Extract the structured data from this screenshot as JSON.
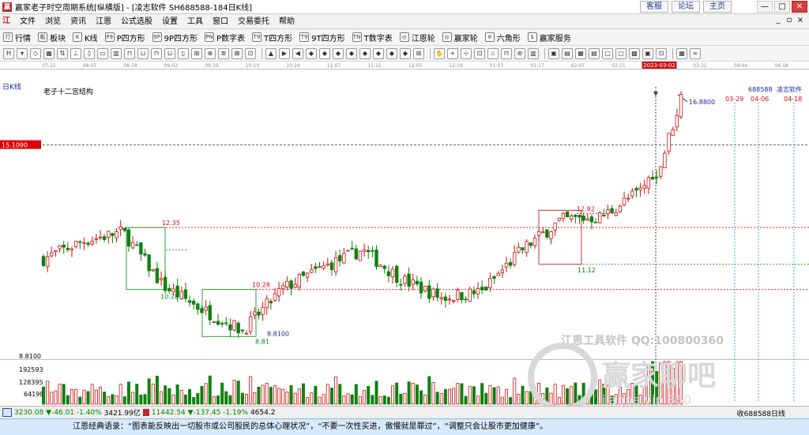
{
  "window": {
    "title": "赢家老子时空周期系统[纵横版] - [凌志软件  SH688588-184日K线]",
    "links": [
      "客服",
      "论坛",
      "主页"
    ],
    "buttons": [
      "—",
      "□",
      "✕"
    ]
  },
  "menu": {
    "items": [
      "文件",
      "浏览",
      "资讯",
      "江恩",
      "公式选股",
      "设置",
      "工具",
      "窗口",
      "交易委托",
      "帮助"
    ]
  },
  "toolbar1": {
    "items": [
      {
        "icon": "行",
        "label": "行情"
      },
      {
        "icon": "板",
        "label": "板块"
      },
      {
        "icon": "K",
        "label": "K线"
      },
      {
        "icon": "P9",
        "label": "P四方形"
      },
      {
        "icon": "9P",
        "label": "9P四方形"
      },
      {
        "icon": "PN",
        "label": "P数字表"
      },
      {
        "icon": "T9",
        "label": "T四方形"
      },
      {
        "icon": "T9",
        "label": "9T四方形"
      },
      {
        "icon": "TN",
        "label": "T数字表"
      },
      {
        "icon": "◎",
        "label": "江恩轮"
      },
      {
        "icon": "◎",
        "label": "赢家轮"
      },
      {
        "icon": "✡",
        "label": "六角形"
      },
      {
        "icon": "$",
        "label": "赢家服务"
      }
    ]
  },
  "chart": {
    "period_label": "日K线",
    "indicator_label": "老子十二宫结构",
    "date_axis": [
      "07-22",
      "08-05",
      "08-18",
      "09-02",
      "09-19",
      "10-10",
      "10-24",
      "11-07",
      "11-21",
      "12-05",
      "12-19",
      "01-03",
      "01-17",
      "02-07",
      "02-21",
      "2023-03-02",
      "03-21",
      "04-04",
      "04-18"
    ],
    "highlight_date": "2023-03-02",
    "current_price_label": "15.1090",
    "volume_axis": [
      "192593",
      "128395",
      "64198"
    ],
    "price_axis_low": "8.8100",
    "max_price_label": "16.8800",
    "future_dates": [
      "03-29",
      "04-06",
      "04-18"
    ],
    "stock_code": "688588",
    "stock_name": "凌志软件",
    "level_labels": [
      "12.35",
      "10.28",
      "10.28",
      "8.8100",
      "8.81",
      "12.82",
      "11.12"
    ],
    "watermark_line1": "江恩工具软件  QQ:100800360",
    "watermark_line2": "赢家聊吧",
    "watermark_line3": "jiaoba.vip 360"
  },
  "chart_data": {
    "type": "candlestick",
    "title": "老子十二宫结构",
    "xlabel": "",
    "ylabel": "",
    "x": [
      "07-22",
      "08-05",
      "08-18",
      "09-02",
      "09-19",
      "10-10",
      "10-24",
      "11-07",
      "11-21",
      "12-05",
      "12-19",
      "01-03",
      "01-17",
      "02-07",
      "02-21",
      "2023-03-02",
      "03-21",
      "04-04",
      "04-18"
    ],
    "ylim": [
      8.0,
      17.5
    ],
    "key_levels": [
      {
        "label": "12.35",
        "value": 12.35
      },
      {
        "label": "10.28",
        "value": 10.28
      },
      {
        "label": "8.8100",
        "value": 8.81
      },
      {
        "label": "12.82",
        "value": 12.82
      },
      {
        "label": "11.12",
        "value": 11.12
      },
      {
        "label": "15.1090",
        "value": 15.109
      },
      {
        "label": "16.8800",
        "value": 16.88
      }
    ],
    "close_path": [
      [
        "07-22",
        11.3
      ],
      [
        "08-05",
        11.9
      ],
      [
        "08-18",
        12.2
      ],
      [
        "09-02",
        10.4
      ],
      [
        "09-19",
        9.6
      ],
      [
        "10-10",
        8.9
      ],
      [
        "10-24",
        10.3
      ],
      [
        "11-07",
        11.0
      ],
      [
        "11-21",
        11.6
      ],
      [
        "12-05",
        10.6
      ],
      [
        "12-19",
        10.0
      ],
      [
        "01-03",
        10.2
      ],
      [
        "01-17",
        11.6
      ],
      [
        "02-07",
        12.6
      ],
      [
        "02-21",
        12.7
      ],
      [
        "2023-03-02",
        13.6
      ],
      [
        "03-21",
        15.6
      ]
    ],
    "volume_axis_ticks": [
      192593,
      128395,
      64198
    ]
  },
  "statusbar": {
    "index1": "3230.08",
    "index1_change": "▼-46.01",
    "index1_pct": "-1.40%",
    "index1_amount": "3421.99亿",
    "index2": "11442.54",
    "index2_change": "▼-137.45",
    "index2_pct": "-1.19%",
    "index2_amount": "4654.2",
    "right_text": "收688588日线"
  },
  "quote": {
    "text": "江恩经典语录：“图表能反映出一切股市或公司股民的总体心理状况”，“不要一次性买进，傲慢就是罪过”，“调整只会让股市更加健康”。"
  },
  "colors": {
    "up": "#d01010",
    "down": "#108010",
    "current_price": "#e00000",
    "guide_cyan": "#2fb7d8"
  }
}
